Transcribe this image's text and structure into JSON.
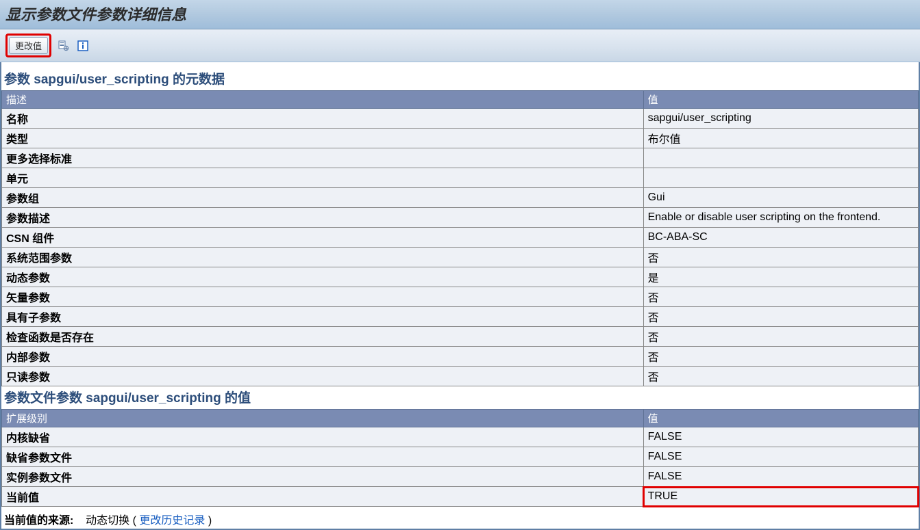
{
  "title": "显示参数文件参数详细信息",
  "toolbar": {
    "change_value_label": "更改值"
  },
  "section1": {
    "title": "参数 sapgui/user_scripting 的元数据",
    "header_desc": "描述",
    "header_value": "值",
    "rows": [
      {
        "label": "名称",
        "value": "sapgui/user_scripting"
      },
      {
        "label": "类型",
        "value": "布尔值"
      },
      {
        "label": "更多选择标准",
        "value": ""
      },
      {
        "label": "单元",
        "value": ""
      },
      {
        "label": "参数组",
        "value": "Gui"
      },
      {
        "label": "参数描述",
        "value": "Enable or disable user scripting on the frontend."
      },
      {
        "label": "CSN 组件",
        "value": "BC-ABA-SC"
      },
      {
        "label": "系统范围参数",
        "value": "否"
      },
      {
        "label": "动态参数",
        "value": "是"
      },
      {
        "label": "矢量参数",
        "value": "否"
      },
      {
        "label": "具有子参数",
        "value": "否"
      },
      {
        "label": "检查函数是否存在",
        "value": "否"
      },
      {
        "label": "内部参数",
        "value": "否"
      },
      {
        "label": "只读参数",
        "value": "否"
      }
    ]
  },
  "section2": {
    "title": "参数文件参数 sapgui/user_scripting 的值",
    "header_desc": "扩展级别",
    "header_value": "值",
    "rows": [
      {
        "label": "内核缺省",
        "value": "FALSE",
        "highlight": false
      },
      {
        "label": "缺省参数文件",
        "value": "FALSE",
        "highlight": false
      },
      {
        "label": "实例参数文件",
        "value": "FALSE",
        "highlight": false
      },
      {
        "label": "当前值",
        "value": "TRUE",
        "highlight": true
      }
    ]
  },
  "footer": {
    "label": "当前值的来源:",
    "text_before": "动态切换 ( ",
    "link": "更改历史记录",
    "text_after": " )"
  }
}
